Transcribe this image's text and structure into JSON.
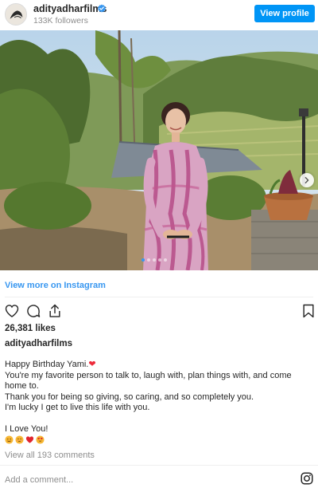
{
  "header": {
    "username": "adityadharfilms",
    "followers": "133K followers",
    "view_profile_label": "View profile",
    "verified_icon": "verified-badge-icon"
  },
  "photo": {
    "description_icon": "post-photo",
    "carousel_pages": 5,
    "carousel_active": 1
  },
  "view_more_label": "View more on Instagram",
  "actions": {
    "like_icon": "heart-icon",
    "comment_icon": "comment-icon",
    "share_icon": "share-icon",
    "save_icon": "bookmark-icon"
  },
  "likes": "26,381 likes",
  "caption": {
    "username": "adityadharfilms",
    "line1": "Happy Birthday Yami.",
    "line2": "You're my favorite person to talk to, laugh with, plan things with, and come home to.",
    "line3": "Thank you for being so giving, so caring, and so completely you.",
    "line4": "I'm lucky I get to live this life with you.",
    "line5": "I Love You!"
  },
  "view_comments": "View all 193 comments",
  "add_comment_placeholder": "Add a comment...",
  "colors": {
    "accent": "#0095f6",
    "link": "#3897f0",
    "heart": "#ed2a3a",
    "muted": "#8e8e8e"
  }
}
